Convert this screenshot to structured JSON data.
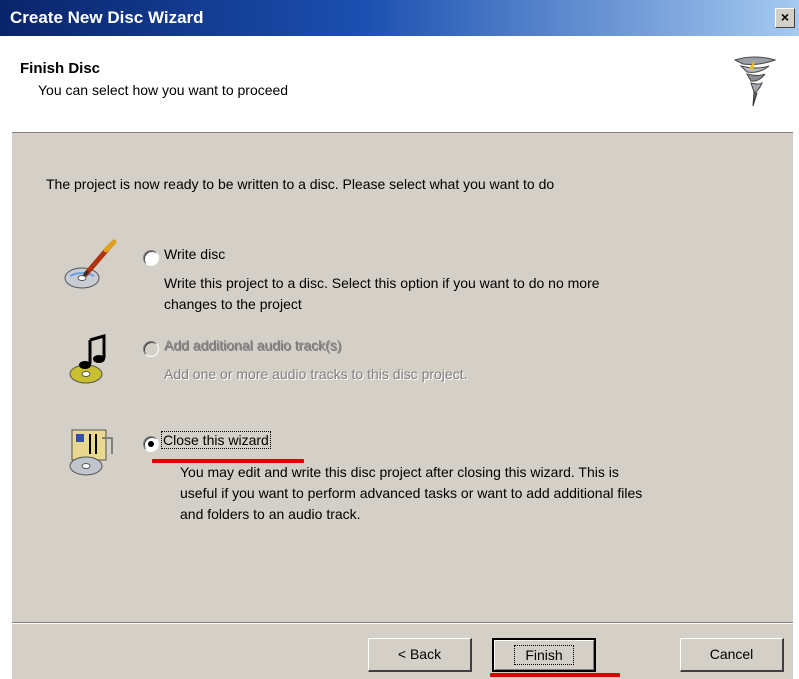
{
  "window": {
    "title": "Create New Disc Wizard",
    "close_glyph": "×"
  },
  "header": {
    "title": "Finish Disc",
    "subtitle": "You can select how you want to proceed",
    "icon": "tornado-wizard-icon"
  },
  "intro_text": "The project is now ready to be written to a disc. Please select what you want to do",
  "options": [
    {
      "label": "Write disc",
      "description_lines": [
        "Write this project to a disc. Select this option if you want to do no more",
        "changes to the project"
      ],
      "selected": false,
      "enabled": true,
      "icon": "write-disc-icon"
    },
    {
      "label": "Add additional audio track(s)",
      "description_lines": [
        "Add one or more audio tracks to this disc project."
      ],
      "selected": false,
      "enabled": false,
      "icon": "audio-track-icon"
    },
    {
      "label": "Close this wizard",
      "description_lines": [
        "You may edit and write this disc project after closing this wizard. This is",
        "useful if you want to perform advanced tasks or want to add additional files",
        "and folders to an audio track."
      ],
      "selected": true,
      "enabled": true,
      "icon": "close-wizard-icon"
    }
  ],
  "buttons": {
    "back": "< Back",
    "finish": "Finish",
    "cancel": "Cancel"
  },
  "colors": {
    "highlight_underline": "#e00000",
    "title_bar": "#0a246a",
    "dialog_face": "#d4d0c8"
  }
}
